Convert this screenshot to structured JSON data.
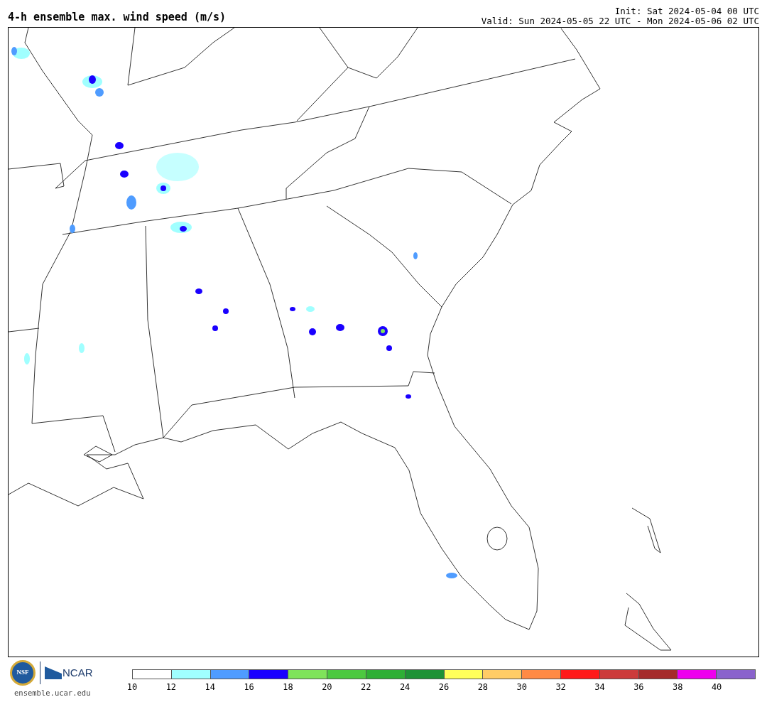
{
  "title": "4-h ensemble max. wind speed (m/s)",
  "init": "Init: Sat 2024-05-04 00 UTC",
  "valid": "Valid: Sun 2024-05-05 22 UTC - Mon 2024-05-06 02 UTC",
  "logos": {
    "nsf": "NSF",
    "ncar": "NCAR",
    "site": "ensemble.ucar.edu"
  },
  "colorbar": {
    "bins": [
      {
        "color": "#ffffff"
      },
      {
        "color": "#a0ffff"
      },
      {
        "color": "#4f9cff"
      },
      {
        "color": "#1a00ff"
      },
      {
        "color": "#7fe35a"
      },
      {
        "color": "#4cc940"
      },
      {
        "color": "#2eaf35"
      },
      {
        "color": "#1e9236"
      },
      {
        "color": "#ffff5a"
      },
      {
        "color": "#ffcc66"
      },
      {
        "color": "#ff8a45"
      },
      {
        "color": "#ff1a1a"
      },
      {
        "color": "#cc3b3b"
      },
      {
        "color": "#a52a2a"
      },
      {
        "color": "#ee00ee"
      },
      {
        "color": "#8a63cc"
      }
    ],
    "labels": [
      "10",
      "12",
      "14",
      "16",
      "18",
      "20",
      "22",
      "24",
      "26",
      "28",
      "30",
      "32",
      "34",
      "36",
      "38",
      "40"
    ]
  }
}
